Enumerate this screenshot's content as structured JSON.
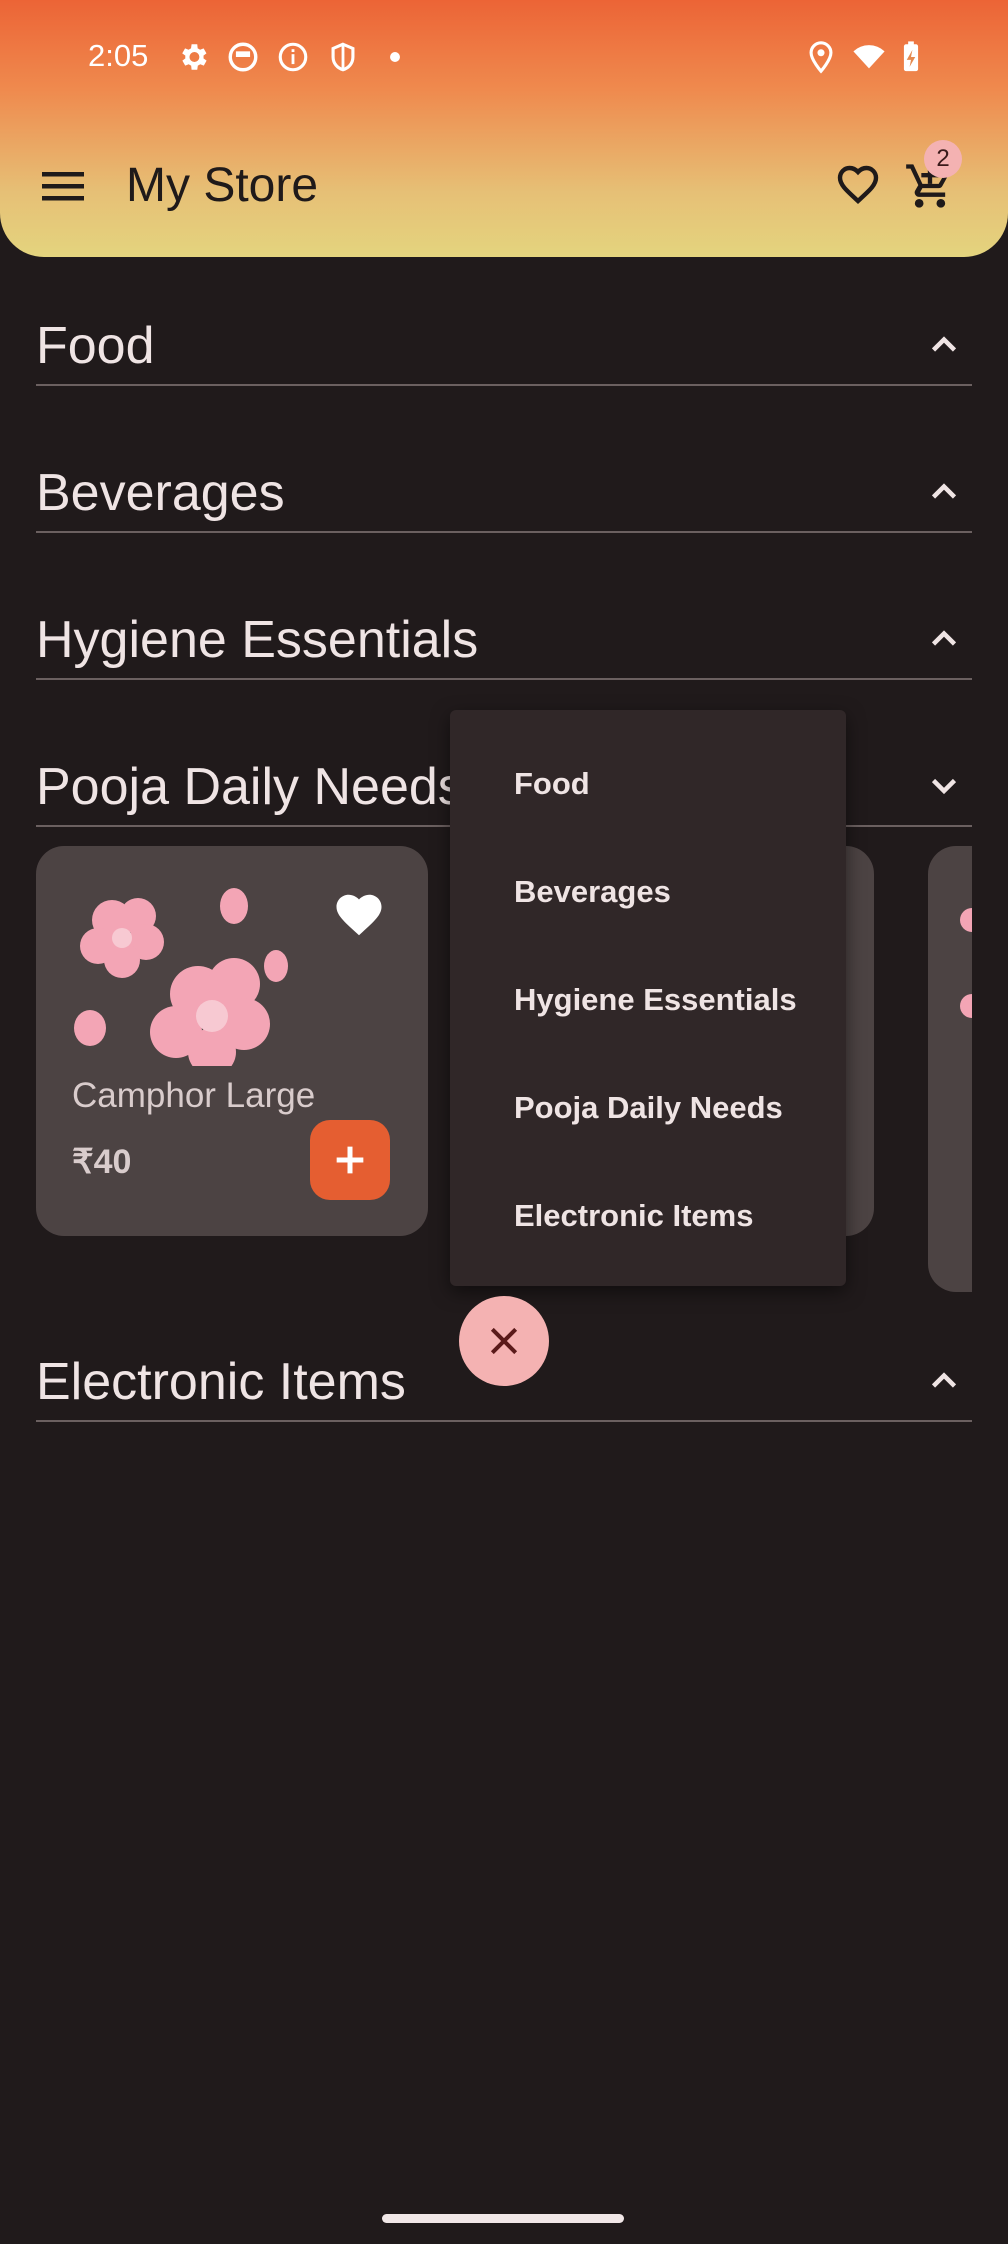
{
  "status_bar": {
    "time": "2:05"
  },
  "app_bar": {
    "title": "My Store",
    "cart_count": "2"
  },
  "sections": [
    {
      "title": "Food",
      "expanded": false
    },
    {
      "title": "Beverages",
      "expanded": false
    },
    {
      "title": "Hygiene Essentials",
      "expanded": false
    },
    {
      "title": "Pooja Daily Needs",
      "expanded": true
    },
    {
      "title": "Electronic Items",
      "expanded": false
    }
  ],
  "product_card": {
    "name": "Camphor Large",
    "price": "₹40",
    "favorited": true
  },
  "dropdown_menu": {
    "items": [
      "Food",
      "Beverages",
      "Hygiene Essentials",
      "Pooja Daily Needs",
      "Electronic Items"
    ]
  },
  "colors": {
    "background": "#201a1b",
    "accent": "#e55e31",
    "fab": "#f4b2b2",
    "card": "#4c4343"
  }
}
